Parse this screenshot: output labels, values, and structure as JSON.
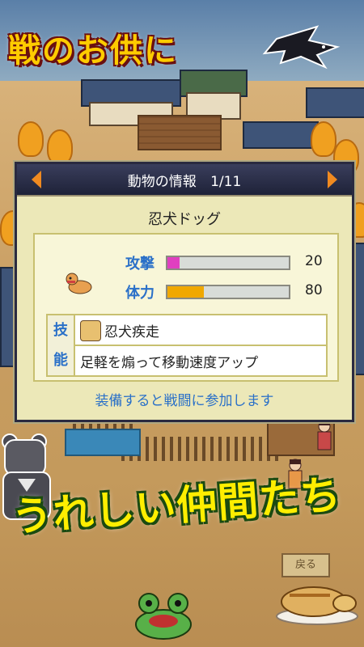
{
  "promo": {
    "top_caption": "戦のお供に",
    "bottom_caption": "うれしい仲間たち"
  },
  "dialog": {
    "header_title": "動物の情報",
    "page_indicator": "1/11",
    "animal_name": "忍犬ドッグ",
    "stats": [
      {
        "label": "攻撃",
        "value": "20",
        "fill_fraction": 0.1,
        "color": "#e040c0"
      },
      {
        "label": "体力",
        "value": "80",
        "fill_fraction": 0.3,
        "color": "#f0a800"
      }
    ],
    "skill": {
      "tag_line1": "技",
      "tag_line2": "能",
      "name": "忍犬疾走",
      "description": "足軽を煽って移動速度アップ"
    },
    "footer_note": "装備すると戦闘に参加します"
  },
  "controls": {
    "back_label": "戻る"
  },
  "icons": {
    "prev": "prev-arrow-icon",
    "next": "next-arrow-icon",
    "pet": "dog-icon",
    "skill": "monkey-skill-icon"
  }
}
